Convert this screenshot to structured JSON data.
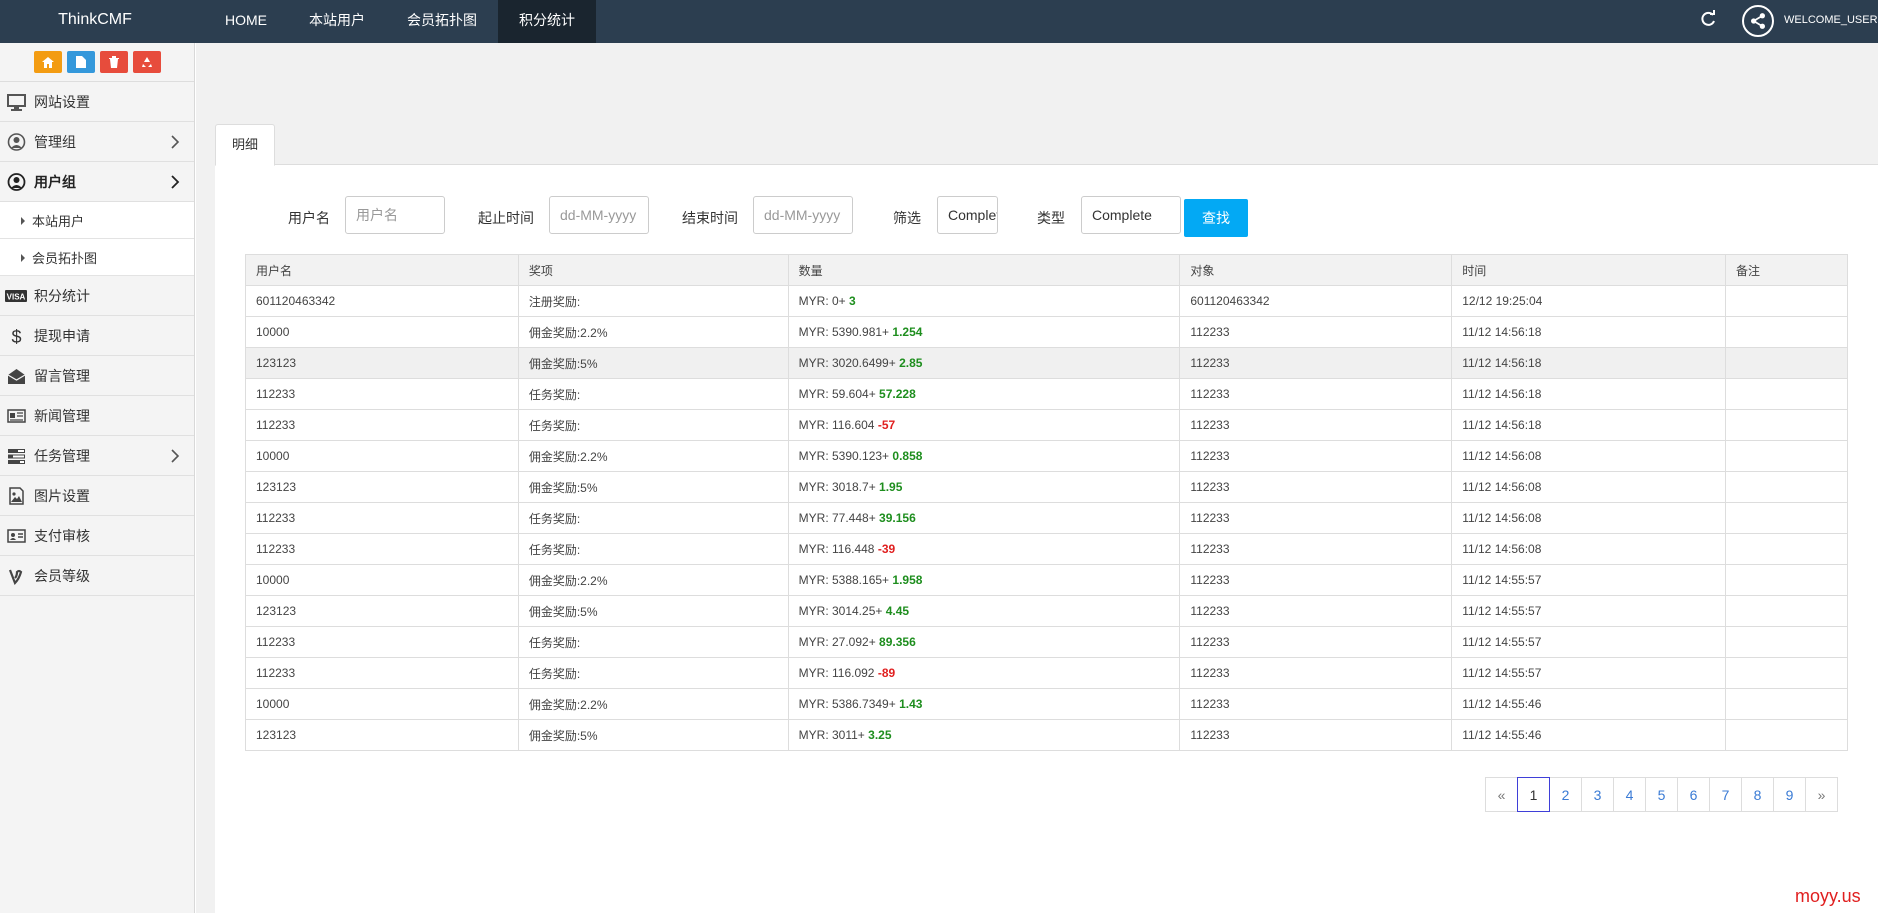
{
  "header": {
    "brand": "ThinkCMF",
    "nav": [
      {
        "label": "HOME",
        "active": false
      },
      {
        "label": "本站用户",
        "active": false
      },
      {
        "label": "会员拓扑图",
        "active": false
      },
      {
        "label": "积分统计",
        "active": true
      }
    ],
    "welcome": "WELCOME_USER"
  },
  "sidebar": {
    "shortcut_colors": [
      "#f39c12",
      "#3498db",
      "#e74c3c",
      "#e74c3c"
    ],
    "items": [
      {
        "label": "网站设置",
        "icon": "monitor-icon"
      },
      {
        "label": "管理组",
        "icon": "user-circle-icon",
        "has_children": true
      },
      {
        "label": "用户组",
        "icon": "user-icon",
        "has_children": true,
        "active": true
      },
      {
        "label": "积分统计",
        "icon": "visa-icon"
      },
      {
        "label": "提现申请",
        "icon": "dollar-icon"
      },
      {
        "label": "留言管理",
        "icon": "envelope-icon"
      },
      {
        "label": "新闻管理",
        "icon": "newspaper-icon"
      },
      {
        "label": "任务管理",
        "icon": "tasks-icon",
        "has_children": true
      },
      {
        "label": "图片设置",
        "icon": "image-icon"
      },
      {
        "label": "支付审核",
        "icon": "id-card-icon"
      },
      {
        "label": "会员等级",
        "icon": "vine-icon"
      }
    ],
    "subitems": [
      {
        "label": "本站用户"
      },
      {
        "label": "会员拓扑图"
      }
    ]
  },
  "tab": {
    "label": "明细"
  },
  "filter": {
    "username_label": "用户名",
    "username_placeholder": "用户名",
    "start_label": "起止时间",
    "start_placeholder": "dd-MM-yyyy",
    "end_label": "结束时间",
    "end_placeholder": "dd-MM-yyyy",
    "screen_label": "筛选",
    "screen_value": "Complete",
    "type_label": "类型",
    "type_value": "Complete",
    "search_label": "查找"
  },
  "table": {
    "headers": [
      "用户名",
      "奖项",
      "数量",
      "对象",
      "时间",
      "备注"
    ],
    "rows": [
      {
        "user": "601120463342",
        "award": "注册奖励:",
        "base": "MYR: 0+",
        "delta": "3",
        "sign": "pos",
        "target": "601120463342",
        "time": "12/12 19:25:04",
        "note": ""
      },
      {
        "user": "10000",
        "award": "佣金奖励:2.2%",
        "base": "MYR: 5390.981+",
        "delta": "1.254",
        "sign": "pos",
        "target": "112233",
        "time": "11/12 14:56:18",
        "note": ""
      },
      {
        "user": "123123",
        "award": "佣金奖励:5%",
        "base": "MYR: 3020.6499+",
        "delta": "2.85",
        "sign": "pos",
        "target": "112233",
        "time": "11/12 14:56:18",
        "note": ""
      },
      {
        "user": "112233",
        "award": "任务奖励:",
        "base": "MYR: 59.604+",
        "delta": "57.228",
        "sign": "pos",
        "target": "112233",
        "time": "11/12 14:56:18",
        "note": ""
      },
      {
        "user": "112233",
        "award": "任务奖励:",
        "base": "MYR: 116.604",
        "delta": "-57",
        "sign": "neg",
        "target": "112233",
        "time": "11/12 14:56:18",
        "note": ""
      },
      {
        "user": "10000",
        "award": "佣金奖励:2.2%",
        "base": "MYR: 5390.123+",
        "delta": "0.858",
        "sign": "pos",
        "target": "112233",
        "time": "11/12 14:56:08",
        "note": ""
      },
      {
        "user": "123123",
        "award": "佣金奖励:5%",
        "base": "MYR: 3018.7+",
        "delta": "1.95",
        "sign": "pos",
        "target": "112233",
        "time": "11/12 14:56:08",
        "note": ""
      },
      {
        "user": "112233",
        "award": "任务奖励:",
        "base": "MYR: 77.448+",
        "delta": "39.156",
        "sign": "pos",
        "target": "112233",
        "time": "11/12 14:56:08",
        "note": ""
      },
      {
        "user": "112233",
        "award": "任务奖励:",
        "base": "MYR: 116.448",
        "delta": "-39",
        "sign": "neg",
        "target": "112233",
        "time": "11/12 14:56:08",
        "note": ""
      },
      {
        "user": "10000",
        "award": "佣金奖励:2.2%",
        "base": "MYR: 5388.165+",
        "delta": "1.958",
        "sign": "pos",
        "target": "112233",
        "time": "11/12 14:55:57",
        "note": ""
      },
      {
        "user": "123123",
        "award": "佣金奖励:5%",
        "base": "MYR: 3014.25+",
        "delta": "4.45",
        "sign": "pos",
        "target": "112233",
        "time": "11/12 14:55:57",
        "note": ""
      },
      {
        "user": "112233",
        "award": "任务奖励:",
        "base": "MYR: 27.092+",
        "delta": "89.356",
        "sign": "pos",
        "target": "112233",
        "time": "11/12 14:55:57",
        "note": ""
      },
      {
        "user": "112233",
        "award": "任务奖励:",
        "base": "MYR: 116.092",
        "delta": "-89",
        "sign": "neg",
        "target": "112233",
        "time": "11/12 14:55:57",
        "note": ""
      },
      {
        "user": "10000",
        "award": "佣金奖励:2.2%",
        "base": "MYR: 5386.7349+",
        "delta": "1.43",
        "sign": "pos",
        "target": "112233",
        "time": "11/12 14:55:46",
        "note": ""
      },
      {
        "user": "123123",
        "award": "佣金奖励:5%",
        "base": "MYR: 3011+",
        "delta": "3.25",
        "sign": "pos",
        "target": "112233",
        "time": "11/12 14:55:46",
        "note": ""
      }
    ]
  },
  "pagination": {
    "prev": "«",
    "next": "»",
    "pages": [
      "1",
      "2",
      "3",
      "4",
      "5",
      "6",
      "7",
      "8",
      "9"
    ],
    "current": "1"
  },
  "watermark": "moyy.us"
}
